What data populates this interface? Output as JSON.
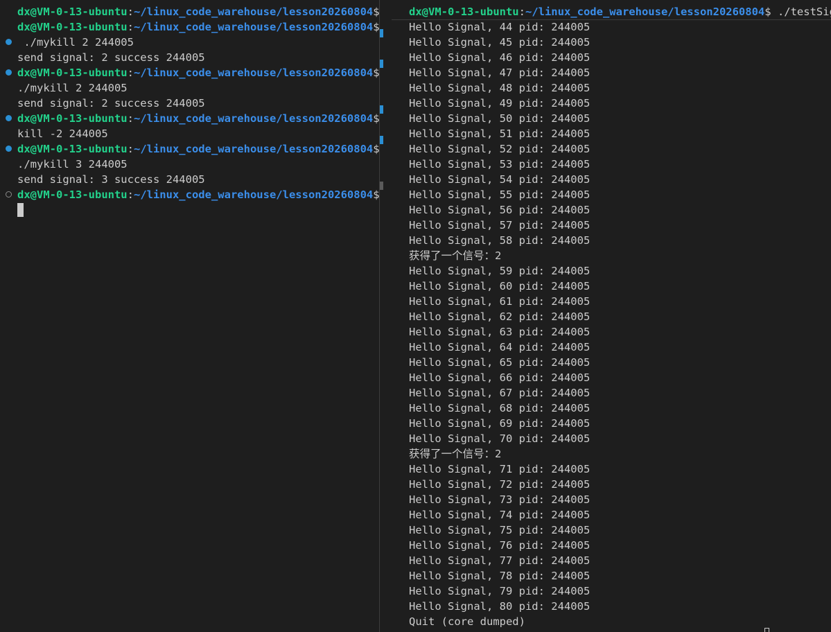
{
  "prompt": {
    "user": "dx@VM-0-13-ubuntu",
    "sep": ":",
    "path": "~/linux_code_warehouse/lesson20260804",
    "symbol": "$"
  },
  "left_terminal": {
    "lines": [
      {
        "type": "prompt"
      },
      {
        "type": "prompt"
      },
      {
        "type": "output",
        "text": " ./mykill 2 244005",
        "decoration": "filled"
      },
      {
        "type": "output",
        "text": "send signal: 2 success 244005"
      },
      {
        "type": "prompt",
        "decoration": "filled"
      },
      {
        "type": "output",
        "text": "./mykill 2 244005"
      },
      {
        "type": "output",
        "text": "send signal: 2 success 244005"
      },
      {
        "type": "prompt",
        "decoration": "filled"
      },
      {
        "type": "output",
        "text": "kill -2 244005"
      },
      {
        "type": "prompt",
        "decoration": "filled"
      },
      {
        "type": "output",
        "text": "./mykill 3 244005"
      },
      {
        "type": "output",
        "text": "send signal: 3 success 244005"
      },
      {
        "type": "prompt",
        "decoration": "hollow"
      }
    ]
  },
  "right_terminal": {
    "command": " ./testSig",
    "lines": [
      "Hello Signal, 44 pid: 244005",
      "Hello Signal, 45 pid: 244005",
      "Hello Signal, 46 pid: 244005",
      "Hello Signal, 47 pid: 244005",
      "Hello Signal, 48 pid: 244005",
      "Hello Signal, 49 pid: 244005",
      "Hello Signal, 50 pid: 244005",
      "Hello Signal, 51 pid: 244005",
      "Hello Signal, 52 pid: 244005",
      "Hello Signal, 53 pid: 244005",
      "Hello Signal, 54 pid: 244005",
      "Hello Signal, 55 pid: 244005",
      "Hello Signal, 56 pid: 244005",
      "Hello Signal, 57 pid: 244005",
      "Hello Signal, 58 pid: 244005",
      "获得了一个信号：2",
      "Hello Signal, 59 pid: 244005",
      "Hello Signal, 60 pid: 244005",
      "Hello Signal, 61 pid: 244005",
      "Hello Signal, 62 pid: 244005",
      "Hello Signal, 63 pid: 244005",
      "Hello Signal, 64 pid: 244005",
      "Hello Signal, 65 pid: 244005",
      "Hello Signal, 66 pid: 244005",
      "Hello Signal, 67 pid: 244005",
      "Hello Signal, 68 pid: 244005",
      "Hello Signal, 69 pid: 244005",
      "Hello Signal, 70 pid: 244005",
      "获得了一个信号：2",
      "Hello Signal, 71 pid: 244005",
      "Hello Signal, 72 pid: 244005",
      "Hello Signal, 73 pid: 244005",
      "Hello Signal, 74 pid: 244005",
      "Hello Signal, 75 pid: 244005",
      "Hello Signal, 76 pid: 244005",
      "Hello Signal, 77 pid: 244005",
      "Hello Signal, 78 pid: 244005",
      "Hello Signal, 79 pid: 244005",
      "Hello Signal, 80 pid: 244005",
      "Quit (core dumped)"
    ]
  },
  "colors": {
    "background": "#1e1e1e",
    "prompt_user": "#23d18b",
    "prompt_path": "#3b8eea",
    "text": "#cccccc",
    "decoration": "#2a8fd4"
  },
  "icons": {
    "command_decoration": "circle-dot-icon",
    "resize": "resize-icon"
  }
}
